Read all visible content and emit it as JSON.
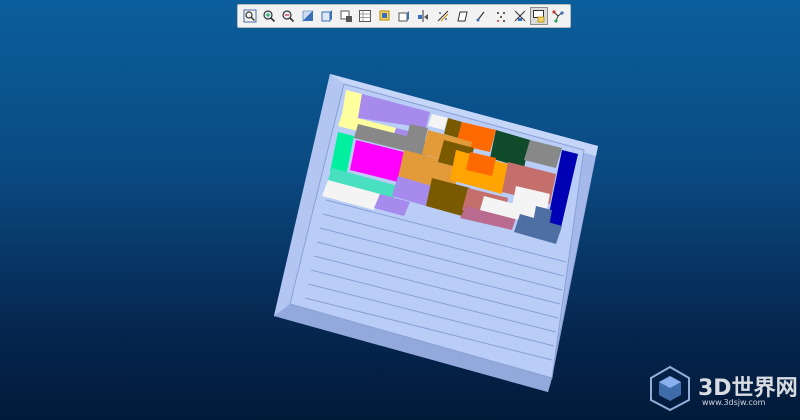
{
  "toolbar": {
    "buttons": [
      {
        "name": "zoom-fit-icon"
      },
      {
        "name": "zoom-in-icon"
      },
      {
        "name": "zoom-out-icon"
      },
      {
        "name": "zoom-area-icon"
      },
      {
        "name": "display-shaded-icon"
      },
      {
        "name": "display-edges-icon"
      },
      {
        "name": "section-view-icon"
      },
      {
        "name": "view-orientation-icon"
      },
      {
        "name": "display-style-icon"
      },
      {
        "name": "hide-show-icon"
      },
      {
        "name": "edit-appearance-icon"
      },
      {
        "name": "apply-scene-icon"
      },
      {
        "name": "view-settings-icon"
      },
      {
        "name": "show-points-icon"
      },
      {
        "name": "show-axes-icon"
      },
      {
        "name": "rotate-view-icon",
        "active": true
      },
      {
        "name": "view-network-icon"
      }
    ]
  },
  "watermark": {
    "title": "3D世界网",
    "url": "www.3dsjw.com"
  },
  "colors": {
    "tray_light": "#b9cdf7",
    "tray_side": "#a4b9ea",
    "tray_line": "#8aa0d4",
    "pieces": [
      "#ffff9e",
      "#a78bec",
      "#888888",
      "#ff6a00",
      "#0f4a2a",
      "#0000b4",
      "#00f0a0",
      "#ff00ff",
      "#e39b3a",
      "#7a5a00",
      "#ffa400",
      "#c56f6c",
      "#48e0c0",
      "#f4f4f4",
      "#4e6fa3",
      "#b86b8f"
    ]
  }
}
